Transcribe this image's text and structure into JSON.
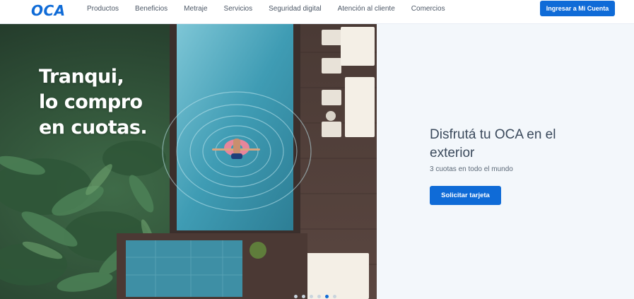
{
  "brand": {
    "logo_text": "OCA",
    "accent_color": "#0f6bd7"
  },
  "header": {
    "nav": [
      {
        "label": "Productos"
      },
      {
        "label": "Beneficios"
      },
      {
        "label": "Metraje"
      },
      {
        "label": "Servicios"
      },
      {
        "label": "Seguridad digital"
      },
      {
        "label": "Atención al cliente"
      },
      {
        "label": "Comercios"
      }
    ],
    "login_button": "Ingresar a Mi Cuenta"
  },
  "hero": {
    "tagline": [
      "Tranqui,",
      "lo compro",
      "en cuotas."
    ],
    "image_alt": "pool-aerial-photo",
    "carousel": {
      "slides": 6,
      "active": 5
    }
  },
  "promo": {
    "title": "Disfrutá tu OCA en el exterior",
    "subtitle": "3 cuotas en todo el mundo",
    "cta": "Solicitar tarjeta"
  }
}
